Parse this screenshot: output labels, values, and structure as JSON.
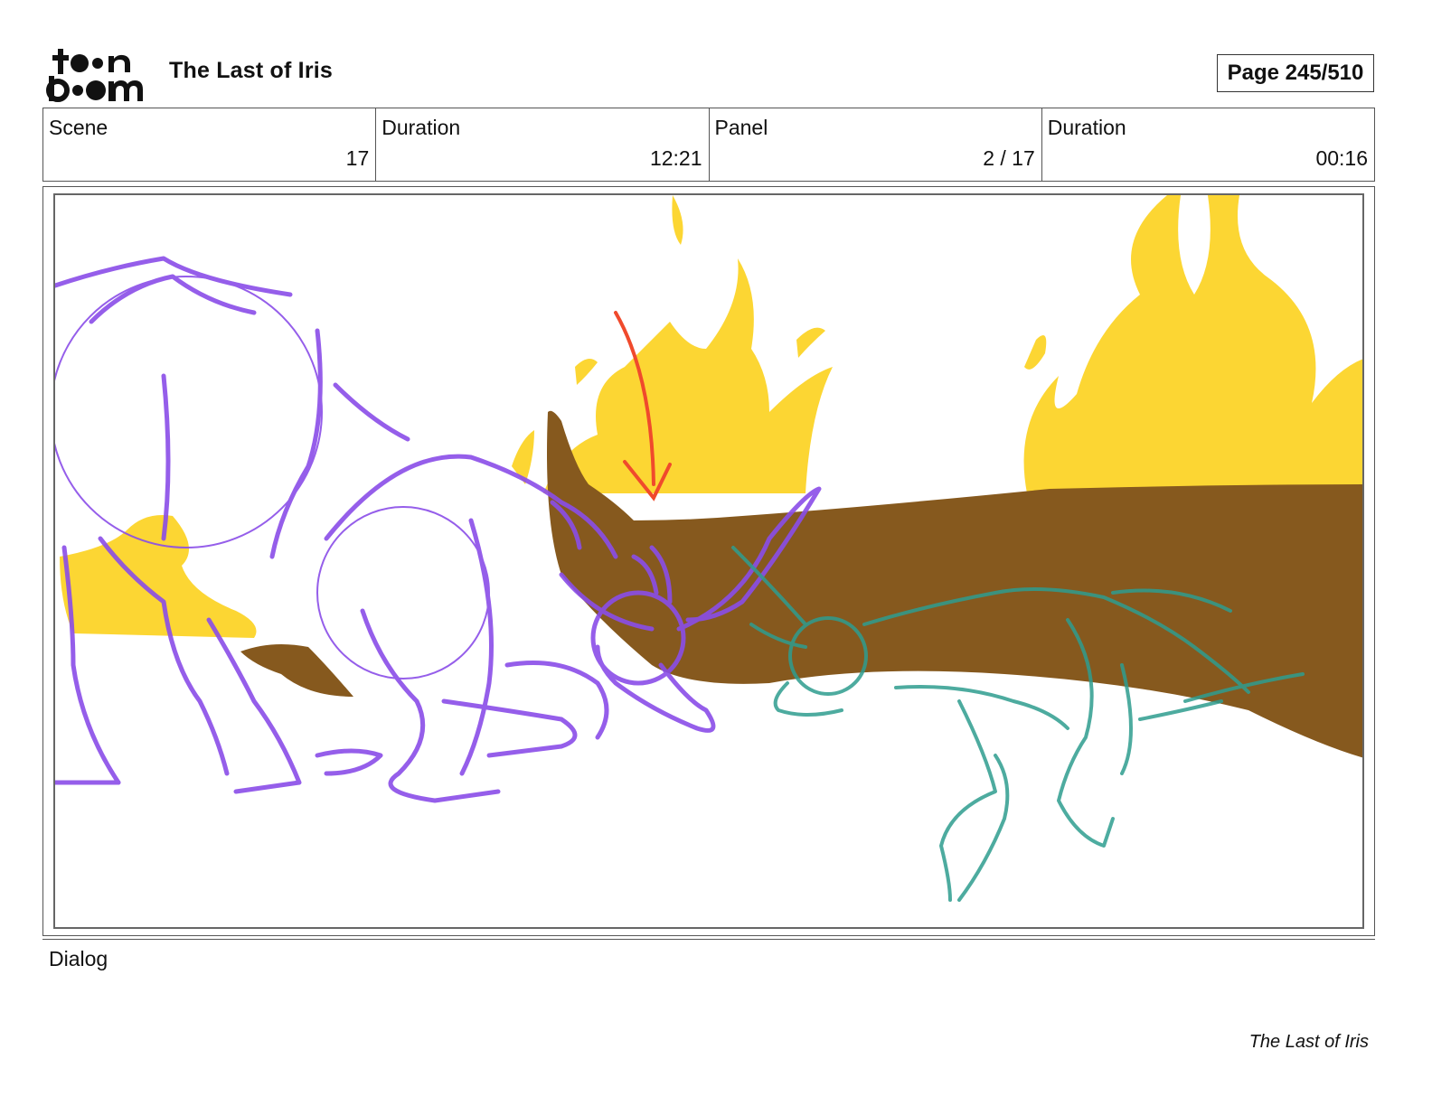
{
  "header": {
    "logo_text": "toon boom",
    "project_title": "The Last of Iris",
    "page_label": "Page 245/510"
  },
  "info": [
    {
      "label": "Scene",
      "value": "17"
    },
    {
      "label": "Duration",
      "value": "12:21"
    },
    {
      "label": "Panel",
      "value": "2 / 17"
    },
    {
      "label": "Duration",
      "value": "00:16"
    }
  ],
  "dialog": {
    "label": "Dialog"
  },
  "footer": {
    "text": "The Last of Iris"
  },
  "colors": {
    "fire": "#fcd633",
    "log": "#86591e",
    "sketch_purple": "#8a4de8",
    "sketch_teal": "#2e9d8f",
    "arrow_red": "#f04a2c"
  }
}
